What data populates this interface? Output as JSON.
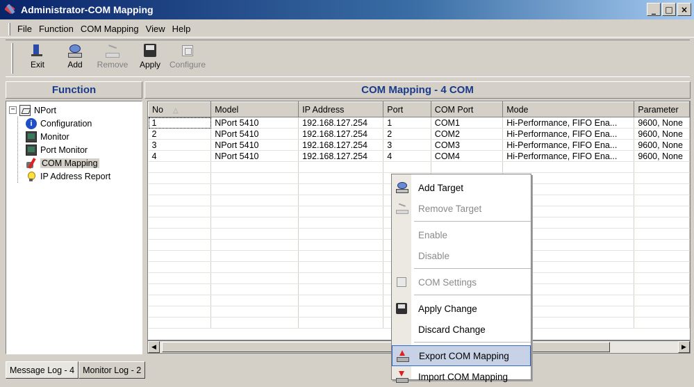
{
  "window": {
    "title": "Administrator-COM Mapping",
    "controls": [
      "_",
      "□",
      "×"
    ]
  },
  "menubar": [
    {
      "label": "File"
    },
    {
      "label": "Function"
    },
    {
      "label": "COM Mapping"
    },
    {
      "label": "View"
    },
    {
      "label": "Help"
    }
  ],
  "toolbar": {
    "exit_label": "Exit",
    "add_label": "Add",
    "remove_label": "Remove",
    "apply_label": "Apply",
    "configure_label": "Configure"
  },
  "left_panel": {
    "header": "Function",
    "tree": {
      "root": "NPort",
      "expander": "−",
      "children": [
        {
          "label": "Configuration",
          "icon": "info-icon"
        },
        {
          "label": "Monitor",
          "icon": "monitor-icon"
        },
        {
          "label": "Port Monitor",
          "icon": "monitor-icon"
        },
        {
          "label": "COM Mapping",
          "icon": "com-mapping-icon",
          "selected": true
        },
        {
          "label": "IP Address Report",
          "icon": "bulb-icon"
        }
      ]
    }
  },
  "right_panel": {
    "header": "COM Mapping - 4 COM",
    "columns": [
      "No",
      "Model",
      "IP Address",
      "Port",
      "COM Port",
      "Mode",
      "Parameter"
    ],
    "sort_indicator": "△",
    "rows": [
      {
        "no": "1",
        "model": "NPort 5410",
        "ip": "192.168.127.254",
        "port": "1",
        "com": "COM1",
        "mode": "Hi-Performance, FIFO Ena...",
        "param": "9600, None"
      },
      {
        "no": "2",
        "model": "NPort 5410",
        "ip": "192.168.127.254",
        "port": "2",
        "com": "COM2",
        "mode": "Hi-Performance, FIFO Ena...",
        "param": "9600, None"
      },
      {
        "no": "3",
        "model": "NPort 5410",
        "ip": "192.168.127.254",
        "port": "3",
        "com": "COM3",
        "mode": "Hi-Performance, FIFO Ena...",
        "param": "9600, None"
      },
      {
        "no": "4",
        "model": "NPort 5410",
        "ip": "192.168.127.254",
        "port": "4",
        "com": "COM4",
        "mode": "Hi-Performance, FIFO Ena...",
        "param": "9600, None"
      }
    ]
  },
  "context_menu": {
    "add_target": "Add Target",
    "remove_target": "Remove Target",
    "enable": "Enable",
    "disable": "Disable",
    "com_settings": "COM Settings",
    "apply_change": "Apply Change",
    "discard_change": "Discard Change",
    "export_com_mapping": "Export COM Mapping",
    "import_com_mapping": "Import COM Mapping"
  },
  "bottom_tabs": [
    {
      "label": "Message Log - 4",
      "active": true
    },
    {
      "label": "Monitor Log - 2",
      "active": false
    }
  ],
  "colors": {
    "title_gradient_start": "#0a246a",
    "panel_header_text": "#1a3a8a",
    "menu_hover": "#316ac5"
  }
}
